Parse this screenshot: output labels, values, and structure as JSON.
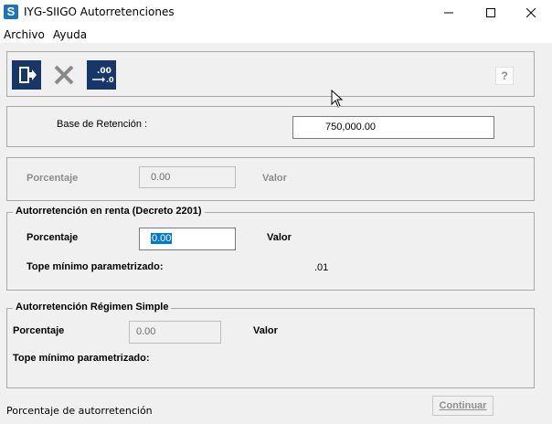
{
  "window": {
    "title": "IYG-SIIGO Autorretenciones",
    "app_icon_letter": "S"
  },
  "menu": {
    "items": [
      "Archivo",
      "Ayuda"
    ]
  },
  "toolbar": {
    "buttons": [
      "exit-icon",
      "cancel-icon",
      "decimal-format-icon"
    ],
    "help_label": "?",
    "format_icon_text": ".00"
  },
  "base": {
    "label": "Base de Retención :",
    "value": "750,000.00"
  },
  "general": {
    "porcentaje_label": "Porcentaje",
    "porcentaje_value": "0.00",
    "valor_label": "Valor"
  },
  "renta": {
    "legend": "Autorretención en renta (Decreto 2201)",
    "porcentaje_label": "Porcentaje",
    "porcentaje_value": "0.00",
    "valor_label": "Valor",
    "tope_label": "Tope mínimo parametrizado:",
    "tope_value": ".01"
  },
  "simple": {
    "legend": "Autorretención Régimen Simple",
    "porcentaje_label": "Porcentaje",
    "porcentaje_value": "0.00",
    "valor_label": "Valor",
    "tope_label": "Tope mínimo parametrizado:"
  },
  "status": {
    "text": "Porcentaje de autorretención"
  },
  "actions": {
    "continue_label": "Continuar"
  },
  "colors": {
    "toolbar_icon_bg": "#17376a",
    "selection": "#0078d7",
    "app_icon": "#1e73b8"
  }
}
